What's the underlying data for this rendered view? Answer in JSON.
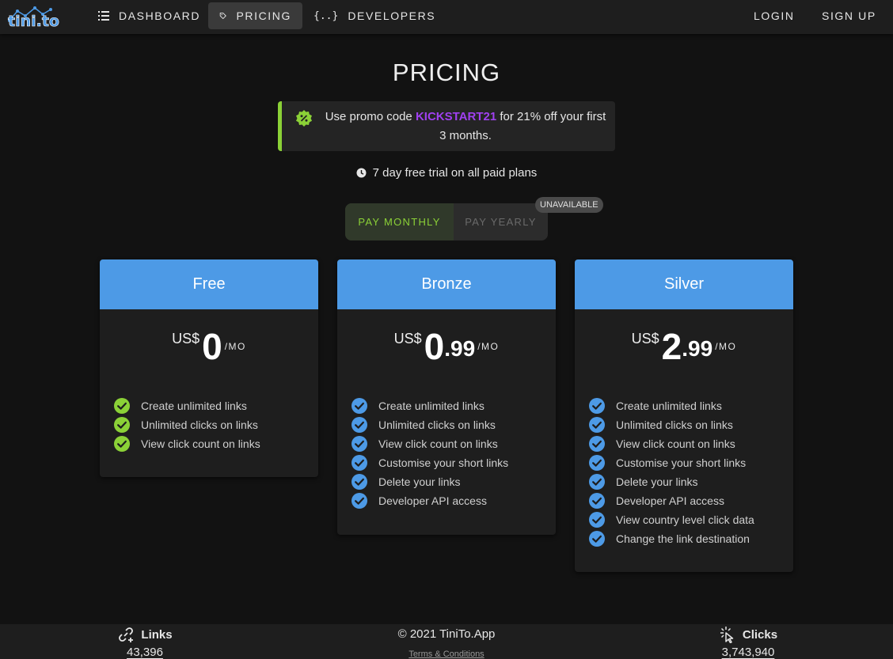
{
  "navbar": {
    "logo_text": "tini.to",
    "items": [
      {
        "label": "Dashboard",
        "icon": "list-icon",
        "active": false
      },
      {
        "label": "Pricing",
        "icon": "tag-icon",
        "active": true
      },
      {
        "label": "Developers",
        "icon": "code-braces-icon",
        "active": false
      }
    ],
    "login": "Login",
    "signup": "Sign Up"
  },
  "page": {
    "title": "PRICING",
    "promo": {
      "prefix": "Use promo code ",
      "code": "KICKSTART21",
      "suffix": " for 21% off your first 3 months.",
      "icon": "discount-badge-icon"
    },
    "trial_text": "7 day free trial on all paid plans",
    "trial_icon": "clock-icon",
    "billing_toggle": {
      "monthly": "Pay Monthly",
      "yearly": "Pay Yearly",
      "selected": "monthly",
      "yearly_badge": "UNAVAILABLE"
    }
  },
  "plans": [
    {
      "name": "Free",
      "currency": "US$",
      "amount": "0",
      "cents": "",
      "period": "/MO",
      "check_color": "#8bd137",
      "features": [
        "Create unlimited links",
        "Unlimited clicks on links",
        "View click count on links"
      ]
    },
    {
      "name": "Bronze",
      "currency": "US$",
      "amount": "0",
      "cents": ".99",
      "period": "/MO",
      "check_color": "#4d9ae6",
      "features": [
        "Create unlimited links",
        "Unlimited clicks on links",
        "View click count on links",
        "Customise your short links",
        "Delete your links",
        "Developer API access"
      ]
    },
    {
      "name": "Silver",
      "currency": "US$",
      "amount": "2",
      "cents": ".99",
      "period": "/MO",
      "check_color": "#4d9ae6",
      "features": [
        "Create unlimited links",
        "Unlimited clicks on links",
        "View click count on links",
        "Customise your short links",
        "Delete your links",
        "Developer API access",
        "View country level click data",
        "Change the link destination"
      ]
    }
  ],
  "footer": {
    "links_label": "Links",
    "links_value": "43,396",
    "links_icon": "link-add-icon",
    "copyright": "© 2021 TiniTo.App",
    "terms": "Terms & Conditions",
    "clicks_label": "Clicks",
    "clicks_value": "3,743,940",
    "clicks_icon": "cursor-click-icon"
  },
  "colors": {
    "accent_green": "#8bd137",
    "accent_blue": "#4d9ae6",
    "promo_code": "#a040f0",
    "background": "#121212",
    "surface": "#1e1e1e"
  }
}
